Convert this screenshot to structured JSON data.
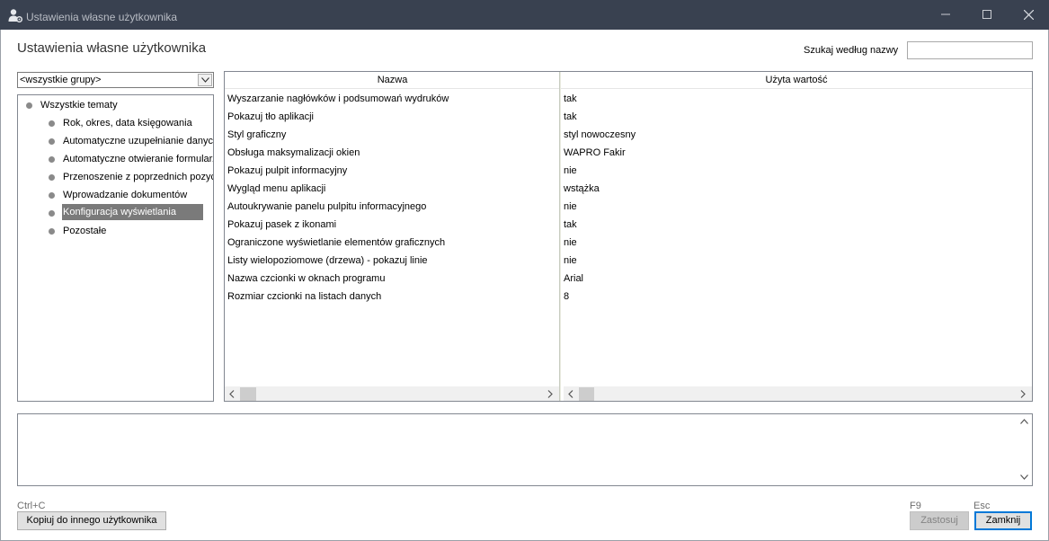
{
  "window": {
    "title": "Ustawienia własne użytkownika",
    "icon": "user-settings-icon"
  },
  "page": {
    "title": "Ustawienia własne użytkownika"
  },
  "search": {
    "label": "Szukaj według nazwy",
    "value": ""
  },
  "group_select": {
    "value": "<wszystkie grupy>"
  },
  "tree": {
    "root": "Wszystkie tematy",
    "items": [
      "Rok, okres, data księgowania",
      "Automatyczne uzupełnianie danych",
      "Automatyczne otwieranie formularzy",
      "Przenoszenie z poprzednich pozycji",
      "Wprowadzanie dokumentów",
      "Konfiguracja wyświetlania",
      "Pozostałe"
    ],
    "selected": "Konfiguracja wyświetlania"
  },
  "grid": {
    "columns": [
      "Nazwa",
      "Użyta wartość"
    ],
    "rows": [
      [
        "Wyszarzanie nagłówków i podsumowań wydruków",
        "tak"
      ],
      [
        "Pokazuj tło aplikacji",
        "tak"
      ],
      [
        "Styl graficzny",
        "styl nowoczesny"
      ],
      [
        "Obsługa maksymalizacji okien",
        "WAPRO Fakir"
      ],
      [
        "Pokazuj pulpit informacyjny",
        "nie"
      ],
      [
        "Wygląd menu aplikacji",
        "wstążka"
      ],
      [
        "Autoukrywanie panelu pulpitu informacyjnego",
        "nie"
      ],
      [
        "Pokazuj pasek z ikonami",
        "tak"
      ],
      [
        "Ograniczone wyświetlanie elementów graficznych",
        "nie"
      ],
      [
        "Listy wielopoziomowe (drzewa) - pokazuj linie",
        "nie"
      ],
      [
        "Nazwa czcionki w oknach programu",
        "Arial"
      ],
      [
        "Rozmiar czcionki na listach danych",
        "8"
      ]
    ]
  },
  "footer": {
    "copy_shortcut": "Ctrl+C",
    "copy_button": "Kopiuj do innego użytkownika",
    "apply_shortcut": "F9",
    "apply_button": "Zastosuj",
    "close_shortcut": "Esc",
    "close_button": "Zamknij"
  }
}
